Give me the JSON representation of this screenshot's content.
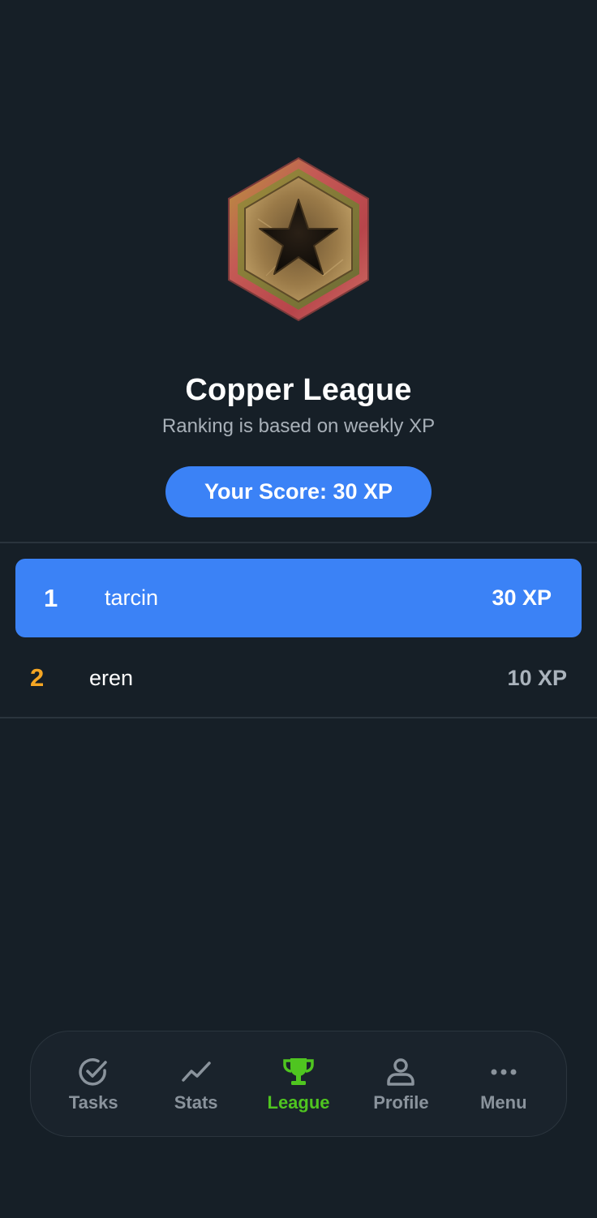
{
  "league": {
    "title": "Copper League",
    "subtitle": "Ranking is based on weekly XP",
    "badge_icon": "hexagon-star-badge",
    "score_label": "Your Score: 30 XP"
  },
  "leaderboard": [
    {
      "rank": "1",
      "name": "tarcin",
      "xp": "30 XP",
      "highlighted": true
    },
    {
      "rank": "2",
      "name": "eren",
      "xp": "10 XP",
      "highlighted": false
    }
  ],
  "tabbar": {
    "items": [
      {
        "label": "Tasks",
        "icon": "check-circle-icon",
        "active": false
      },
      {
        "label": "Stats",
        "icon": "trend-line-icon",
        "active": false
      },
      {
        "label": "League",
        "icon": "trophy-icon",
        "active": true
      },
      {
        "label": "Profile",
        "icon": "person-icon",
        "active": false
      },
      {
        "label": "Menu",
        "icon": "more-dots-icon",
        "active": false
      }
    ]
  },
  "colors": {
    "background": "#161f27",
    "accent": "#3b82f6",
    "active_tab": "#4fc520",
    "rank_secondary": "#f5a623"
  }
}
